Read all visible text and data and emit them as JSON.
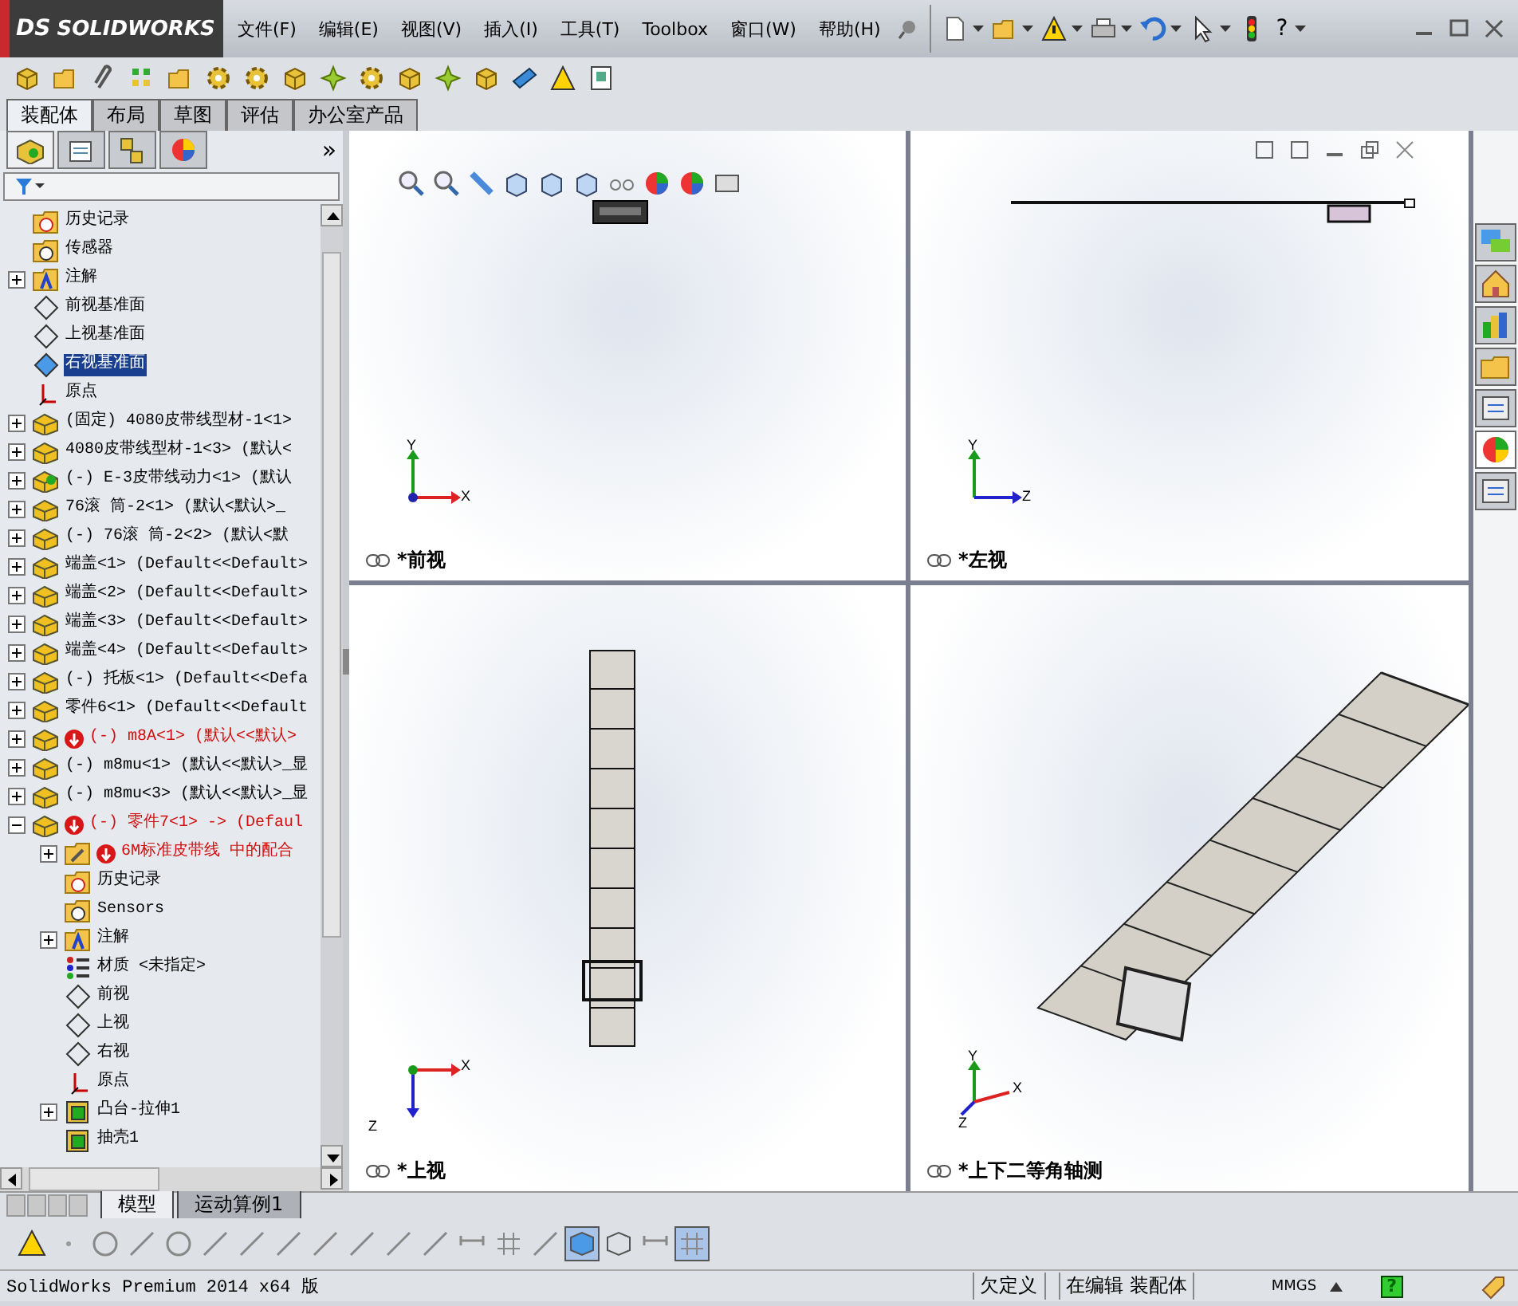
{
  "app": {
    "logo": "SOLIDWORKS",
    "logo_mark": "DS"
  },
  "menu": [
    "文件(F)",
    "编辑(E)",
    "视图(V)",
    "插入(I)",
    "工具(T)",
    "Toolbox",
    "窗口(W)",
    "帮助(H)"
  ],
  "help_glyph": "?",
  "command_tabs": [
    {
      "label": "装配体",
      "selected": true
    },
    {
      "label": "布局",
      "selected": false
    },
    {
      "label": "草图",
      "selected": false
    },
    {
      "label": "评估",
      "selected": false
    },
    {
      "label": "办公室产品",
      "selected": false
    }
  ],
  "panel_tabs": [
    {
      "kind": "feature",
      "selected": true
    },
    {
      "kind": "property",
      "selected": false
    },
    {
      "kind": "config",
      "selected": false
    },
    {
      "kind": "display",
      "selected": false
    }
  ],
  "panel_more": "»",
  "tree": [
    {
      "label": "历史记录",
      "kind": "history",
      "error": false,
      "selected": false
    },
    {
      "label": "传感器",
      "kind": "sensor",
      "error": false,
      "selected": false
    },
    {
      "label": "注解",
      "kind": "annotation",
      "error": false,
      "selected": false,
      "expanded": false
    },
    {
      "label": "前视基准面",
      "kind": "plane",
      "error": false,
      "selected": false
    },
    {
      "label": "上视基准面",
      "kind": "plane",
      "error": false,
      "selected": false
    },
    {
      "label": "右视基准面",
      "kind": "plane",
      "error": false,
      "selected": true
    },
    {
      "label": "原点",
      "kind": "origin",
      "error": false,
      "selected": false
    },
    {
      "label": "(固定) 4080皮带线型材-1<1>",
      "kind": "part",
      "error": false,
      "selected": false,
      "expanded": false
    },
    {
      "label": "4080皮带线型材-1<3> (默认<",
      "kind": "part",
      "error": false,
      "selected": false,
      "expanded": false
    },
    {
      "label": "(-) E-3皮带线动力<1> (默认",
      "kind": "assembly",
      "error": false,
      "selected": false,
      "expanded": false
    },
    {
      "label": "76滚 筒-2<1> (默认<默认>_",
      "kind": "part",
      "error": false,
      "selected": false,
      "expanded": false
    },
    {
      "label": "(-) 76滚 筒-2<2> (默认<默",
      "kind": "part",
      "error": false,
      "selected": false,
      "expanded": false
    },
    {
      "label": "端盖<1> (Default<<Default>",
      "kind": "part",
      "error": false,
      "selected": false,
      "expanded": false
    },
    {
      "label": "端盖<2> (Default<<Default>",
      "kind": "part",
      "error": false,
      "selected": false,
      "expanded": false
    },
    {
      "label": "端盖<3> (Default<<Default>",
      "kind": "part",
      "error": false,
      "selected": false,
      "expanded": false
    },
    {
      "label": "端盖<4> (Default<<Default>",
      "kind": "part",
      "error": false,
      "selected": false,
      "expanded": false
    },
    {
      "label": "(-) 托板<1> (Default<<Defa",
      "kind": "part",
      "error": false,
      "selected": false,
      "expanded": false
    },
    {
      "label": "零件6<1> (Default<<Default",
      "kind": "part",
      "error": false,
      "selected": false,
      "expanded": false
    },
    {
      "label": "(-) m8A<1> (默认<<默认>",
      "kind": "part",
      "error": true,
      "selected": false,
      "expanded": false
    },
    {
      "label": "(-) m8mu<1> (默认<<默认>_显",
      "kind": "part",
      "error": false,
      "selected": false,
      "expanded": false
    },
    {
      "label": "(-) m8mu<3> (默认<<默认>_显",
      "kind": "part",
      "error": false,
      "selected": false,
      "expanded": false
    },
    {
      "label": "(-) 零件7<1> -> (Defaul",
      "kind": "part",
      "error": true,
      "selected": false,
      "expanded": true,
      "children": [
        {
          "label": "6M标准皮带线 中的配合",
          "kind": "mates",
          "error": true,
          "selected": false,
          "expanded": false
        },
        {
          "label": "历史记录",
          "kind": "history",
          "error": false,
          "selected": false
        },
        {
          "label": "Sensors",
          "kind": "sensor",
          "error": false,
          "selected": false
        },
        {
          "label": "注解",
          "kind": "annotation",
          "error": false,
          "selected": false,
          "expanded": false
        },
        {
          "label": "材质 <未指定>",
          "kind": "material",
          "error": false,
          "selected": false
        },
        {
          "label": "前视",
          "kind": "plane",
          "error": false,
          "selected": false
        },
        {
          "label": "上视",
          "kind": "plane",
          "error": false,
          "selected": false
        },
        {
          "label": "右视",
          "kind": "plane",
          "error": false,
          "selected": false
        },
        {
          "label": "原点",
          "kind": "origin",
          "error": false,
          "selected": false
        },
        {
          "label": "凸台-拉伸1",
          "kind": "boss",
          "error": false,
          "selected": false,
          "expanded": false
        },
        {
          "label": "抽壳1",
          "kind": "shell",
          "error": false,
          "selected": false
        }
      ]
    }
  ],
  "viewports": [
    {
      "label": "*前视",
      "kind": "front",
      "axis_labels": [
        "Y",
        "X"
      ]
    },
    {
      "label": "*左视",
      "kind": "left",
      "axis_labels": [
        "Y",
        "Z"
      ]
    },
    {
      "label": "*上视",
      "kind": "top",
      "axis_labels": [
        "X",
        "Z"
      ]
    },
    {
      "label": "*上下二等角轴测",
      "kind": "iso",
      "axis_labels": [
        "Y",
        "X",
        "Z"
      ]
    }
  ],
  "task_pane": [
    {
      "selected": false
    },
    {
      "selected": false
    },
    {
      "selected": false
    },
    {
      "selected": false
    },
    {
      "selected": false
    },
    {
      "selected": true
    },
    {
      "selected": false
    }
  ],
  "bottom_tabs": [
    {
      "label": "模型",
      "selected": true
    },
    {
      "label": "运动算例1",
      "selected": false
    }
  ],
  "status": {
    "product": "SolidWorks Premium 2014 x64 版",
    "definition": "欠定义",
    "mode": "在编辑 装配体",
    "units": "MMGS",
    "help": "?"
  }
}
